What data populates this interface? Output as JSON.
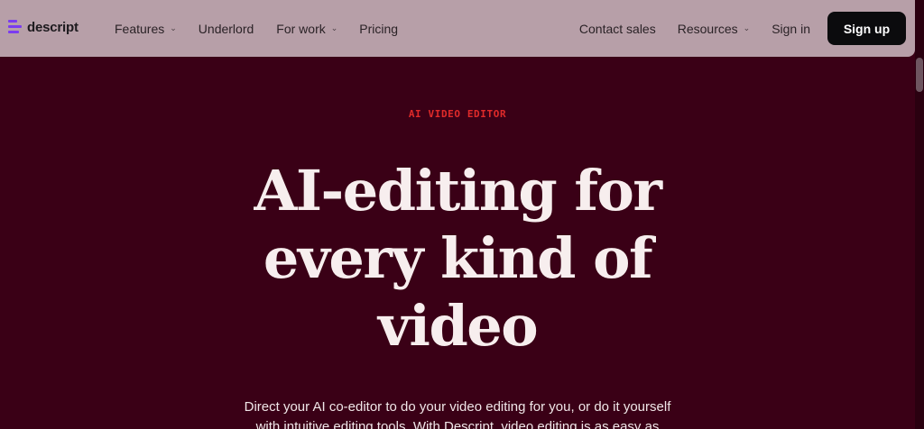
{
  "header": {
    "logo_text": "descript",
    "nav_left": [
      {
        "label": "Features",
        "has_dropdown": true
      },
      {
        "label": "Underlord",
        "has_dropdown": false
      },
      {
        "label": "For work",
        "has_dropdown": true
      },
      {
        "label": "Pricing",
        "has_dropdown": false
      }
    ],
    "nav_right": [
      {
        "label": "Contact sales",
        "has_dropdown": false
      },
      {
        "label": "Resources",
        "has_dropdown": true
      },
      {
        "label": "Sign in",
        "has_dropdown": false
      }
    ],
    "signup_label": "Sign up",
    "dropdown_glyph": "⌄"
  },
  "hero": {
    "eyebrow": "AI VIDEO EDITOR",
    "headline_lines": [
      "AI-editing for",
      "every kind of",
      "video"
    ],
    "subtext": "Direct your AI co-editor to do your video editing for you, or do it yourself with intuitive editing tools. With Descript, video editing is as easy as"
  },
  "colors": {
    "header_bg": "#b79fa8",
    "page_bg": "#3a0016",
    "eyebrow": "#e02a2a",
    "logo_accent": "#7b3cf0",
    "signup_bg": "#0b0b0d"
  }
}
